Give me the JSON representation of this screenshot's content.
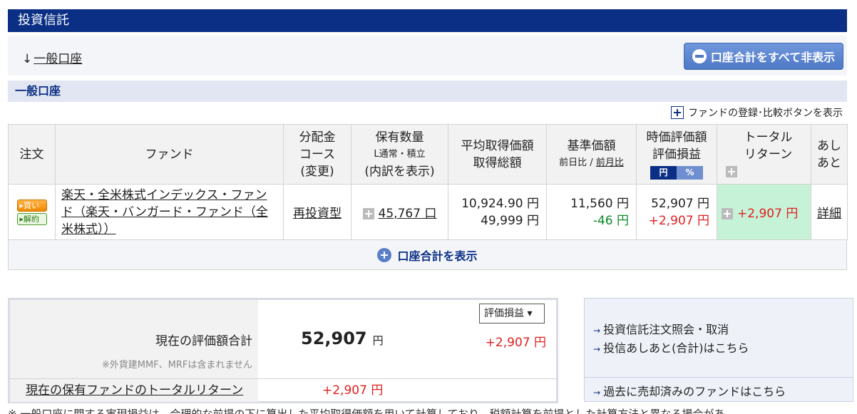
{
  "page_title": "投資信託",
  "anchor": {
    "arrow": "↓",
    "label": "一般口座"
  },
  "hide_all_button": "口座合計をすべて非表示",
  "section_title": "一般口座",
  "fund_toggle_label": "ファンドの登録･比較ボタンを表示",
  "table": {
    "headers": {
      "order": "注文",
      "fund": "ファンド",
      "dist_1": "分配金",
      "dist_2": "コース",
      "dist_3": "(変更)",
      "qty_1": "保有数量",
      "qty_2": "L通常・積立",
      "qty_3": "(内訳を表示)",
      "avg_1": "平均取得価額",
      "avg_2": "取得総額",
      "base_1": "基準価額",
      "base_2": "前日比",
      "base_sep": " / ",
      "base_3": "前月比",
      "mkt_1": "時価評価額",
      "mkt_2": "評価損益",
      "tab_yen": "円",
      "tab_pct": "%",
      "total_1": "トータル",
      "total_2": "リターン",
      "ashi_1": "あし",
      "ashi_2": "あと"
    },
    "row": {
      "buy": "▸買い",
      "sell": "▸解約",
      "fund_name": "楽天・全米株式インデックス・ファンド（楽天・バンガード・ファンド（全米株式））",
      "course": "再投資型",
      "quantity": "45,767 口",
      "avg_price": "10,924.90 円",
      "total_cost": "49,999 円",
      "base_price": "11,560 円",
      "day_change": "-46 円",
      "market_value": "52,907 円",
      "gain": "+2,907 円",
      "total_return": "+2,907 円",
      "detail": "詳細"
    }
  },
  "show_total_label": "口座合計を表示",
  "summary": {
    "label": "現在の評価額合計",
    "note": "※外貨建MMF、MRFは含まれません",
    "value": "52,907",
    "unit": "円",
    "gain": "+2,907 円",
    "select": "評価損益 ▾",
    "total_return_label": "現在の保有ファンドのトータルリターン",
    "total_return_value": "+2,907 円"
  },
  "links": [
    "投資信託注文照会・取消",
    "投信あしあと(合計)はこちら",
    "過去に売却済みのファンドはこちら"
  ],
  "footnote": "※ 一般口座に関する実現損益は、合理的な前提の下に算出した平均取得価額を用いて計算しており、税額計算を前提とした計算方法と異なる場合があ",
  "colors": {
    "title_bar": "#0b2f84",
    "gain_red": "#e02020",
    "loss_green": "#0b8a2b",
    "total_bg": "#c6f2d8"
  }
}
